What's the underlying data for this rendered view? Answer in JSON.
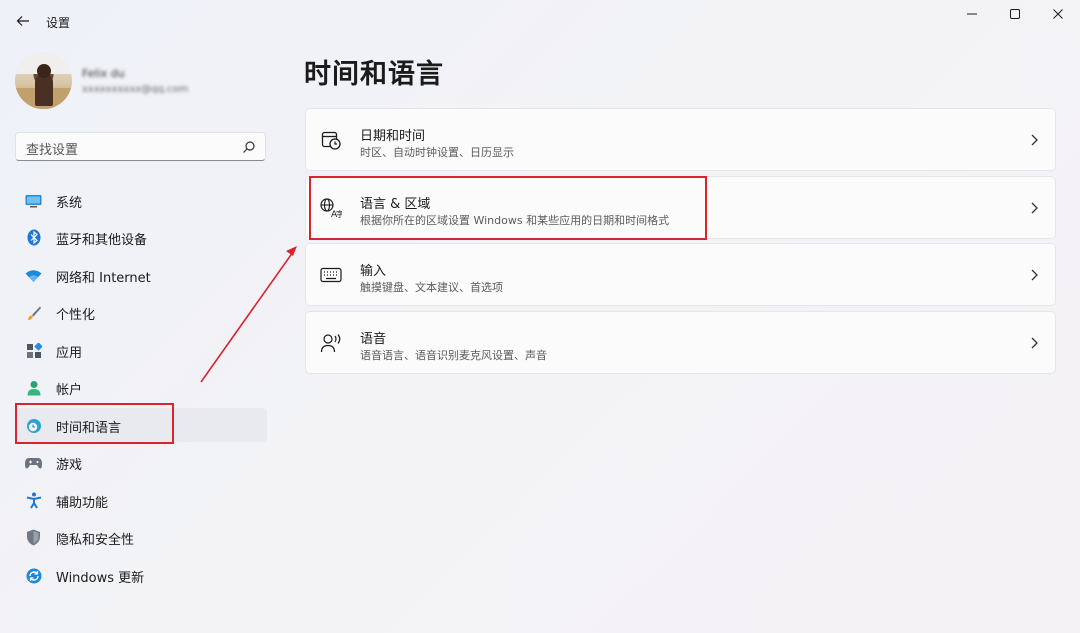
{
  "window": {
    "title": "设置"
  },
  "profile": {
    "name": "Felix du",
    "email": "xxxxxxxxxx@qq.com"
  },
  "search": {
    "placeholder": "查找设置"
  },
  "sidebar": {
    "items": [
      {
        "label": "系统",
        "icon": "monitor-icon",
        "selected": false
      },
      {
        "label": "蓝牙和其他设备",
        "icon": "bluetooth-icon",
        "selected": false
      },
      {
        "label": "网络和 Internet",
        "icon": "wifi-icon",
        "selected": false
      },
      {
        "label": "个性化",
        "icon": "brush-icon",
        "selected": false
      },
      {
        "label": "应用",
        "icon": "apps-icon",
        "selected": false
      },
      {
        "label": "帐户",
        "icon": "person-icon",
        "selected": false
      },
      {
        "label": "时间和语言",
        "icon": "globe-clock-icon",
        "selected": true
      },
      {
        "label": "游戏",
        "icon": "gamepad-icon",
        "selected": false
      },
      {
        "label": "辅助功能",
        "icon": "accessibility-icon",
        "selected": false
      },
      {
        "label": "隐私和安全性",
        "icon": "shield-icon",
        "selected": false
      },
      {
        "label": "Windows 更新",
        "icon": "update-icon",
        "selected": false
      }
    ]
  },
  "main": {
    "title": "时间和语言",
    "cards": [
      {
        "title": "日期和时间",
        "desc": "时区、自动时钟设置、日历显示",
        "icon": "calendar-clock-icon"
      },
      {
        "title": "语言 & 区域",
        "desc": "根据你所在的区域设置 Windows 和某些应用的日期和时间格式",
        "icon": "language-icon"
      },
      {
        "title": "输入",
        "desc": "触摸键盘、文本建议、首选项",
        "icon": "keyboard-icon"
      },
      {
        "title": "语音",
        "desc": "语音语言、语音识别麦克风设置、声音",
        "icon": "speech-icon"
      }
    ]
  },
  "colors": {
    "highlight_box": "#d6252e",
    "accent": "#0067c0"
  }
}
